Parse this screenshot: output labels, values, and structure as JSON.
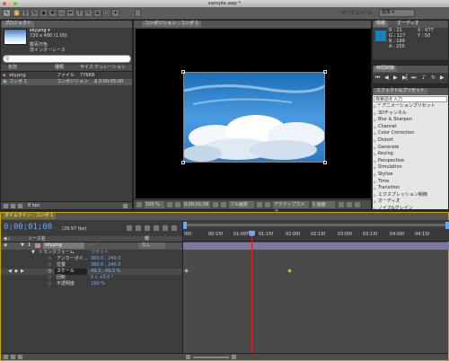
{
  "window": {
    "title": "sample.aep *"
  },
  "toolbar": {
    "workspace_label": "ワークスペース:",
    "workspace_value": "標準"
  },
  "project": {
    "tab": "プロジェクト",
    "footage_name": "sky.png ▾",
    "footage_dims": "720 x 480 (1.00)",
    "footage_info1": "数百万色",
    "footage_info2": "非インターレース",
    "search_placeholder": "",
    "col_name": "名前",
    "col_type": "種類",
    "col_size": "サイズ",
    "col_duration": "デュレーション",
    "items": [
      {
        "name": "sky.png",
        "type": "ファイル",
        "size": "776KB",
        "duration": ""
      },
      {
        "name": "コンポ 1",
        "type": "コンポジション",
        "size": "",
        "duration": "Δ 0:00:05:00"
      }
    ],
    "bpc": "8 bpc"
  },
  "composition": {
    "tab": "コンポジション : コンポ 1",
    "zoom": "100 %",
    "timecode": "0;00;01;08",
    "resolution": "フル画質",
    "camera": "アクティブカメラ",
    "views": "1 画面"
  },
  "info": {
    "tab_info": "情報",
    "tab_audio": "オーディオ",
    "r": "R : 21",
    "g": "G : 127",
    "b": "B : 189",
    "a": "A : 255",
    "x": "X : 677",
    "y": "Y : 50",
    "swatch_color": "#1a7fbd"
  },
  "preview": {
    "tab": "時間制御"
  },
  "effects": {
    "tab": "エフェクト&プリセット",
    "search_label": "検索語を入力",
    "items": [
      "* アニメーションプリセット",
      "3Dチャンネル",
      "Blur & Sharpen",
      "Channel",
      "Color Correction",
      "Distort",
      "Generate",
      "Keying",
      "Perspective",
      "Simulation",
      "Stylize",
      "Time",
      "Transition",
      "エクスプレッション制御",
      "オーディオ",
      "ノイズ&グレイン",
      "シミュレーション"
    ]
  },
  "timeline": {
    "tab": "タイムライン : コンポ 1",
    "timecode": "0;00;01;08",
    "fps": "(29.97 fps)",
    "col_source": "ソース名",
    "col_parent": "親",
    "parent_value": "なし",
    "layer_num": "1",
    "layer_name": "sky.png",
    "transform_label": "トランスフォーム",
    "reset_label": "リセット",
    "props": [
      {
        "label": "アンカーポイ...",
        "value": "360.0 , 240.0"
      },
      {
        "label": "位置",
        "value": "360.0 , 240.0"
      },
      {
        "label": "スケール",
        "value": "49.3 , 49.3 %"
      },
      {
        "label": "回転",
        "value": "0 x +0.0 °"
      },
      {
        "label": "不透明度",
        "value": "100 %"
      }
    ],
    "ruler_labels": [
      "00f",
      "00:15f",
      "01:00f",
      "01:15f",
      "02:00f",
      "02:15f",
      "03:00f",
      "03:15f",
      "04:00f",
      "04:15f"
    ]
  }
}
